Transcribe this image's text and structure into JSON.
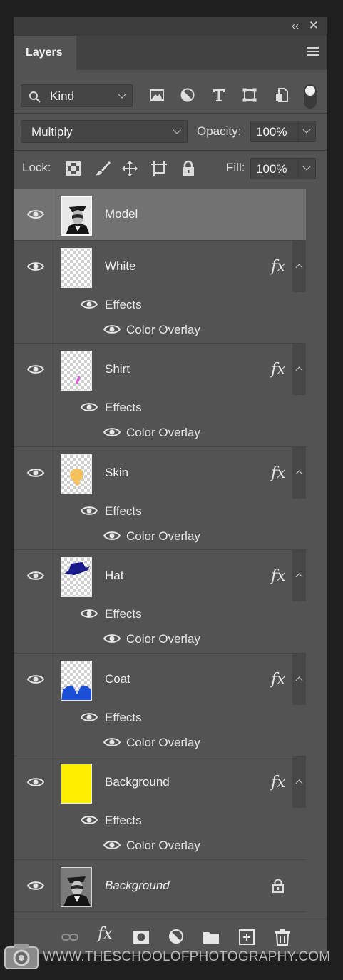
{
  "panel": {
    "collapse_glyph": "‹‹",
    "close_glyph": "✕",
    "tab_label": "Layers",
    "menu_icon": "hamburger-icon"
  },
  "filter": {
    "kind_label": "Kind",
    "icons": [
      "image-filter-icon",
      "adjustment-filter-icon",
      "type-filter-icon",
      "shape-filter-icon",
      "smart-object-filter-icon"
    ]
  },
  "blend": {
    "mode": "Multiply",
    "opacity_label": "Opacity:",
    "opacity_value": "100%"
  },
  "lock": {
    "label": "Lock:",
    "fill_label": "Fill:",
    "fill_value": "100%"
  },
  "layers": [
    {
      "name": "Model",
      "selected": true,
      "thumb": "photo",
      "has_fx": false
    },
    {
      "name": "White",
      "thumb": "transparent",
      "has_fx": true,
      "effects_label": "Effects",
      "effect": "Color Overlay"
    },
    {
      "name": "Shirt",
      "thumb": "shirt",
      "thumb_color": "#e060d8",
      "has_fx": true,
      "effects_label": "Effects",
      "effect": "Color Overlay"
    },
    {
      "name": "Skin",
      "thumb": "skin",
      "thumb_color": "#f6c05c",
      "has_fx": true,
      "effects_label": "Effects",
      "effect": "Color Overlay"
    },
    {
      "name": "Hat",
      "thumb": "hat",
      "thumb_color": "#1a1a8c",
      "has_fx": true,
      "effects_label": "Effects",
      "effect": "Color Overlay"
    },
    {
      "name": "Coat",
      "thumb": "coat",
      "thumb_color": "#1a4fd6",
      "has_fx": true,
      "effects_label": "Effects",
      "effect": "Color Overlay"
    },
    {
      "name": "Background",
      "thumb": "solid",
      "thumb_color": "#ffee00",
      "has_fx": true,
      "effects_label": "Effects",
      "effect": "Color Overlay"
    },
    {
      "name": "Background",
      "thumb": "photo",
      "italic": true,
      "locked": true,
      "has_fx": false
    }
  ],
  "fx_label": "fx",
  "bottom_icons": [
    "link-layers-icon",
    "fx-icon",
    "mask-icon",
    "adjustment-icon",
    "group-folder-icon",
    "new-layer-icon",
    "trash-icon"
  ],
  "watermark": {
    "text": "WWW.THESCHOOLOFPHOTOGRAPHY.COM"
  }
}
